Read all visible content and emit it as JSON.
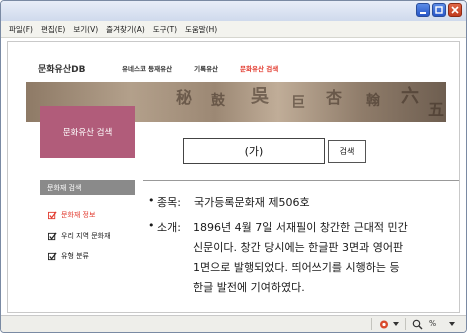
{
  "menu": [
    "파일(F)",
    "편집(E)",
    "보기(V)",
    "즐겨찾기(A)",
    "도구(T)",
    "도움말(H)"
  ],
  "site": {
    "logo": "문화유산DB",
    "nav": [
      "유네스코 등재유산",
      "기록유산",
      "문화유산 검색"
    ],
    "active_nav": 2,
    "side_title": "문화유산 검색"
  },
  "search": {
    "query": "(가)",
    "button_label": "검색"
  },
  "sidebar": {
    "heading": "문화재 검색",
    "items": [
      {
        "label": "문화재 정보",
        "active": true
      },
      {
        "label": "우리 지역 문화재",
        "active": false
      },
      {
        "label": "유형 분류",
        "active": false
      }
    ]
  },
  "info": {
    "bullet": "•",
    "designation_label": "종목:",
    "designation_value": "국가등록문화재 제506호",
    "intro_label": "소개:",
    "intro_lines": [
      "1896년 4월 7일 서재필이 창간한 근대적 민간",
      "신문이다. 창간 당시에는 한글판 3면과 영어판",
      "1면으로 발행되었다. 띄어쓰기를 시행하는 등",
      "한글 발전에 기여하였다."
    ]
  },
  "status": {
    "zoom_label": "%"
  },
  "colors": {
    "accent": "#e23a2e",
    "side_title_bg": "#b15c7a",
    "sidebar_head_bg": "#8a8a8a",
    "titlebar_blue": "#2756c7"
  }
}
